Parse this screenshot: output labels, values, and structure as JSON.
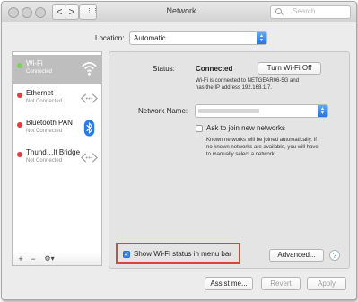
{
  "window": {
    "title": "Network"
  },
  "search": {
    "placeholder": "Search"
  },
  "nav": {
    "back": "<",
    "forward": ">",
    "grid": "⋮⋮⋮"
  },
  "location": {
    "label": "Location:",
    "value": "Automatic"
  },
  "services": [
    {
      "name": "Wi-Fi",
      "status": "Connected",
      "dot_color": "#7ed05a",
      "icon": "wifi-icon",
      "selected": true
    },
    {
      "name": "Ethernet",
      "status": "Not Connected",
      "dot_color": "#e9393e",
      "icon": "ethernet-icon"
    },
    {
      "name": "Bluetooth PAN",
      "status": "Not Connected",
      "dot_color": "#e9393e",
      "icon": "bluetooth-icon"
    },
    {
      "name": "Thund…lt Bridge",
      "status": "Not Connected",
      "dot_color": "#e9393e",
      "icon": "ethernet-icon"
    }
  ],
  "sidebar_footer": {
    "add": "+",
    "remove": "−",
    "gear": "⚙▾"
  },
  "detail": {
    "status_label": "Status:",
    "status_value": "Connected",
    "toggle_button": "Turn Wi-Fi Off",
    "status_desc_line1": "Wi-Fi is connected to NETGEAR06-5G and",
    "status_desc_line2": "has the IP address 192.168.1.7.",
    "network_name_label": "Network Name:",
    "ask_join_label": "Ask to join new networks",
    "ask_desc_line1": "Known networks will be joined automatically. If",
    "ask_desc_line2": "no known networks are available, you will have",
    "ask_desc_line3": "to manually select a network.",
    "show_status_label": "Show Wi-Fi status in menu bar",
    "show_status_checked": true,
    "advanced_button": "Advanced...",
    "help": "?"
  },
  "bottom": {
    "assist": "Assist me...",
    "revert": "Revert",
    "apply": "Apply"
  },
  "colors": {
    "accent": "#3b86ee",
    "highlight_box": "#d9473c"
  }
}
